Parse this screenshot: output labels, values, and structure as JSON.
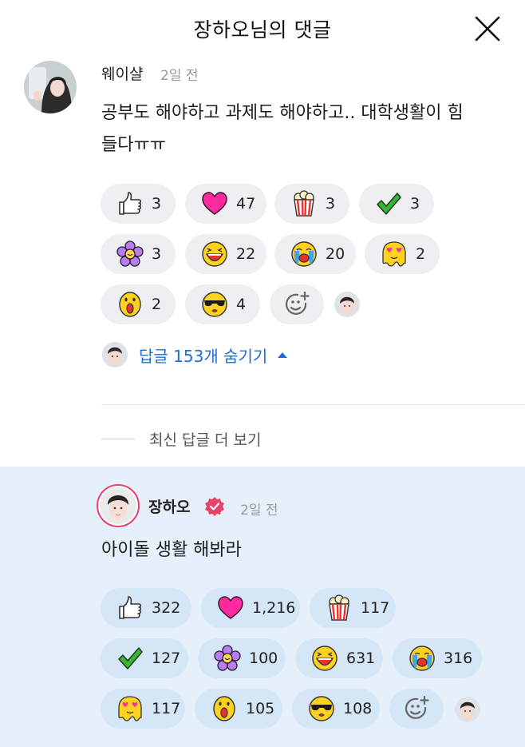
{
  "header": {
    "title": "장하오님의 댓글",
    "close_icon": "close-icon"
  },
  "comment": {
    "author": "웨이샬",
    "time": "2일 전",
    "text_line1": "공부도 해야하고 과제도 해야하고.. 대학생활이 힘",
    "text_line2": "들다ㅠㅠ",
    "reactions": [
      {
        "icon": "thumbs-up-icon",
        "count": "3"
      },
      {
        "icon": "heart-icon",
        "count": "47"
      },
      {
        "icon": "popcorn-icon",
        "count": "3"
      },
      {
        "icon": "check-icon",
        "count": "3"
      },
      {
        "icon": "flower-icon",
        "count": "3"
      },
      {
        "icon": "laughing-face-icon",
        "count": "22"
      },
      {
        "icon": "crying-face-icon",
        "count": "20"
      },
      {
        "icon": "heart-eyes-melting-icon",
        "count": "2"
      },
      {
        "icon": "shocked-face-icon",
        "count": "2"
      },
      {
        "icon": "sunglasses-face-icon",
        "count": "4"
      }
    ],
    "add_reaction_icon": "add-emoji-icon"
  },
  "replies_toggle": {
    "label": "답글 153개 숨기기"
  },
  "more_replies": {
    "label": "최신 답글 더 보기"
  },
  "reply": {
    "author": "장하오",
    "time": "2일 전",
    "text": "아이돌 생활 해봐라",
    "verified_color": "#e8426b",
    "reactions": [
      {
        "icon": "thumbs-up-icon",
        "count": "322"
      },
      {
        "icon": "heart-icon",
        "count": "1,216"
      },
      {
        "icon": "popcorn-icon",
        "count": "117"
      },
      {
        "icon": "check-icon",
        "count": "127"
      },
      {
        "icon": "flower-icon",
        "count": "100"
      },
      {
        "icon": "laughing-face-icon",
        "count": "631"
      },
      {
        "icon": "crying-face-icon",
        "count": "316"
      },
      {
        "icon": "heart-eyes-melting-icon",
        "count": "117"
      },
      {
        "icon": "shocked-face-icon",
        "count": "105"
      },
      {
        "icon": "sunglasses-face-icon",
        "count": "108"
      }
    ],
    "add_reaction_icon": "add-emoji-icon"
  },
  "colors": {
    "link_blue": "#1d6fd8",
    "chip_gray": "#efeff1",
    "reply_bg": "#e6f0fb",
    "chip_blue": "#d5e6f7"
  }
}
